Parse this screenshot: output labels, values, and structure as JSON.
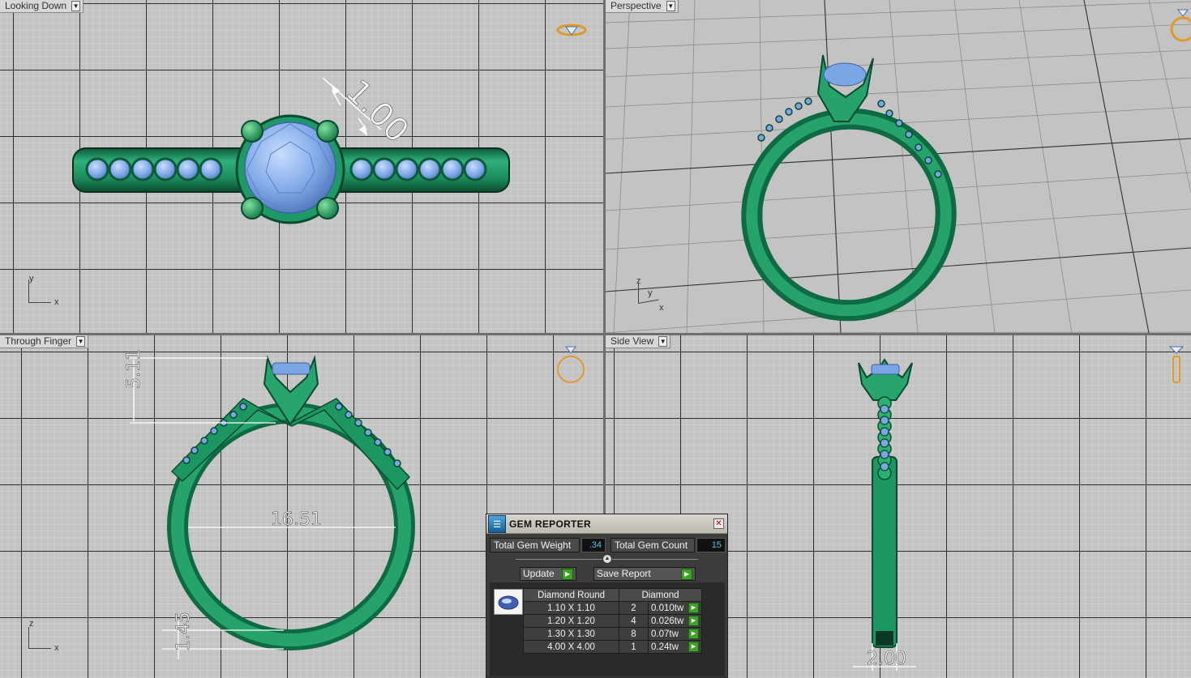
{
  "viewports": {
    "top": {
      "label": "Looking Down",
      "axis_x": "x",
      "axis_y": "y",
      "dimension": "1.00"
    },
    "perspective": {
      "label": "Perspective",
      "axis_x": "x",
      "axis_y": "y",
      "axis_z": "z"
    },
    "front": {
      "label": "Through Finger",
      "axis_x": "x",
      "axis_z": "z",
      "dim_height": "5.11",
      "dim_inner": "16.51",
      "dim_shank": "1.45"
    },
    "side": {
      "label": "Side View",
      "dim_width": "2.00"
    }
  },
  "gem_reporter": {
    "title": "GEM REPORTER",
    "total_weight_label": "Total Gem Weight",
    "total_weight_value": ".34",
    "total_count_label": "Total Gem Count",
    "total_count_value": "15",
    "update_label": "Update",
    "save_label": "Save Report",
    "table": {
      "headers": [
        "Diamond Round",
        "Diamond"
      ],
      "rows": [
        {
          "size": "1.10 X 1.10",
          "count": "2",
          "weight": "0.010tw"
        },
        {
          "size": "1.20 X 1.20",
          "count": "4",
          "weight": "0.026tw"
        },
        {
          "size": "1.30 X 1.30",
          "count": "8",
          "weight": "0.07tw"
        },
        {
          "size": "4.00 X 4.00",
          "count": "1",
          "weight": "0.24tw"
        }
      ]
    }
  },
  "colors": {
    "metal": "#1f9a66",
    "metal_dark": "#0d5a3a",
    "gem": "#7aa6e6",
    "viewport_bg": "#c3c3c3",
    "badge": "#e09a2a"
  },
  "icons": [
    "dropdown-arrow-icon",
    "diamond-ring-icon",
    "close-icon",
    "play-arrow-icon",
    "gem-thumbnail-icon"
  ]
}
